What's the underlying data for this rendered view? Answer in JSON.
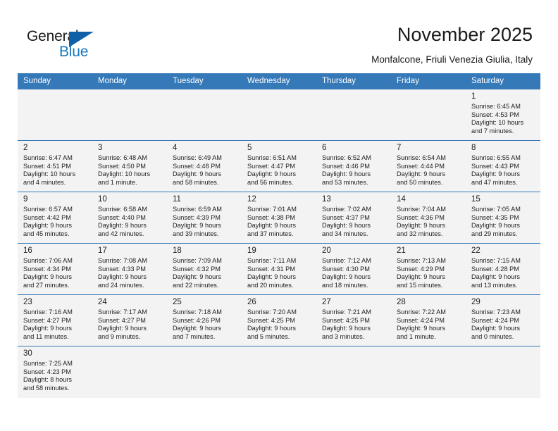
{
  "brand": {
    "name_part1": "General",
    "name_part2": "Blue",
    "triangle_icon": "triangle-icon",
    "accent_color": "#1878be"
  },
  "header": {
    "month_title": "November 2025",
    "location": "Monfalcone, Friuli Venezia Giulia, Italy",
    "header_bg_color": "#3579b8"
  },
  "weekday_headers": [
    "Sunday",
    "Monday",
    "Tuesday",
    "Wednesday",
    "Thursday",
    "Friday",
    "Saturday"
  ],
  "weeks": [
    [
      {
        "empty": true
      },
      {
        "empty": true
      },
      {
        "empty": true
      },
      {
        "empty": true
      },
      {
        "empty": true
      },
      {
        "empty": true
      },
      {
        "day": "1",
        "sunrise": "Sunrise: 6:45 AM",
        "sunset": "Sunset: 4:53 PM",
        "daylight_1": "Daylight: 10 hours",
        "daylight_2": "and 7 minutes."
      }
    ],
    [
      {
        "day": "2",
        "sunrise": "Sunrise: 6:47 AM",
        "sunset": "Sunset: 4:51 PM",
        "daylight_1": "Daylight: 10 hours",
        "daylight_2": "and 4 minutes."
      },
      {
        "day": "3",
        "sunrise": "Sunrise: 6:48 AM",
        "sunset": "Sunset: 4:50 PM",
        "daylight_1": "Daylight: 10 hours",
        "daylight_2": "and 1 minute."
      },
      {
        "day": "4",
        "sunrise": "Sunrise: 6:49 AM",
        "sunset": "Sunset: 4:48 PM",
        "daylight_1": "Daylight: 9 hours",
        "daylight_2": "and 58 minutes."
      },
      {
        "day": "5",
        "sunrise": "Sunrise: 6:51 AM",
        "sunset": "Sunset: 4:47 PM",
        "daylight_1": "Daylight: 9 hours",
        "daylight_2": "and 56 minutes."
      },
      {
        "day": "6",
        "sunrise": "Sunrise: 6:52 AM",
        "sunset": "Sunset: 4:46 PM",
        "daylight_1": "Daylight: 9 hours",
        "daylight_2": "and 53 minutes."
      },
      {
        "day": "7",
        "sunrise": "Sunrise: 6:54 AM",
        "sunset": "Sunset: 4:44 PM",
        "daylight_1": "Daylight: 9 hours",
        "daylight_2": "and 50 minutes."
      },
      {
        "day": "8",
        "sunrise": "Sunrise: 6:55 AM",
        "sunset": "Sunset: 4:43 PM",
        "daylight_1": "Daylight: 9 hours",
        "daylight_2": "and 47 minutes."
      }
    ],
    [
      {
        "day": "9",
        "sunrise": "Sunrise: 6:57 AM",
        "sunset": "Sunset: 4:42 PM",
        "daylight_1": "Daylight: 9 hours",
        "daylight_2": "and 45 minutes."
      },
      {
        "day": "10",
        "sunrise": "Sunrise: 6:58 AM",
        "sunset": "Sunset: 4:40 PM",
        "daylight_1": "Daylight: 9 hours",
        "daylight_2": "and 42 minutes."
      },
      {
        "day": "11",
        "sunrise": "Sunrise: 6:59 AM",
        "sunset": "Sunset: 4:39 PM",
        "daylight_1": "Daylight: 9 hours",
        "daylight_2": "and 39 minutes."
      },
      {
        "day": "12",
        "sunrise": "Sunrise: 7:01 AM",
        "sunset": "Sunset: 4:38 PM",
        "daylight_1": "Daylight: 9 hours",
        "daylight_2": "and 37 minutes."
      },
      {
        "day": "13",
        "sunrise": "Sunrise: 7:02 AM",
        "sunset": "Sunset: 4:37 PM",
        "daylight_1": "Daylight: 9 hours",
        "daylight_2": "and 34 minutes."
      },
      {
        "day": "14",
        "sunrise": "Sunrise: 7:04 AM",
        "sunset": "Sunset: 4:36 PM",
        "daylight_1": "Daylight: 9 hours",
        "daylight_2": "and 32 minutes."
      },
      {
        "day": "15",
        "sunrise": "Sunrise: 7:05 AM",
        "sunset": "Sunset: 4:35 PM",
        "daylight_1": "Daylight: 9 hours",
        "daylight_2": "and 29 minutes."
      }
    ],
    [
      {
        "day": "16",
        "sunrise": "Sunrise: 7:06 AM",
        "sunset": "Sunset: 4:34 PM",
        "daylight_1": "Daylight: 9 hours",
        "daylight_2": "and 27 minutes."
      },
      {
        "day": "17",
        "sunrise": "Sunrise: 7:08 AM",
        "sunset": "Sunset: 4:33 PM",
        "daylight_1": "Daylight: 9 hours",
        "daylight_2": "and 24 minutes."
      },
      {
        "day": "18",
        "sunrise": "Sunrise: 7:09 AM",
        "sunset": "Sunset: 4:32 PM",
        "daylight_1": "Daylight: 9 hours",
        "daylight_2": "and 22 minutes."
      },
      {
        "day": "19",
        "sunrise": "Sunrise: 7:11 AM",
        "sunset": "Sunset: 4:31 PM",
        "daylight_1": "Daylight: 9 hours",
        "daylight_2": "and 20 minutes."
      },
      {
        "day": "20",
        "sunrise": "Sunrise: 7:12 AM",
        "sunset": "Sunset: 4:30 PM",
        "daylight_1": "Daylight: 9 hours",
        "daylight_2": "and 18 minutes."
      },
      {
        "day": "21",
        "sunrise": "Sunrise: 7:13 AM",
        "sunset": "Sunset: 4:29 PM",
        "daylight_1": "Daylight: 9 hours",
        "daylight_2": "and 15 minutes."
      },
      {
        "day": "22",
        "sunrise": "Sunrise: 7:15 AM",
        "sunset": "Sunset: 4:28 PM",
        "daylight_1": "Daylight: 9 hours",
        "daylight_2": "and 13 minutes."
      }
    ],
    [
      {
        "day": "23",
        "sunrise": "Sunrise: 7:16 AM",
        "sunset": "Sunset: 4:27 PM",
        "daylight_1": "Daylight: 9 hours",
        "daylight_2": "and 11 minutes."
      },
      {
        "day": "24",
        "sunrise": "Sunrise: 7:17 AM",
        "sunset": "Sunset: 4:27 PM",
        "daylight_1": "Daylight: 9 hours",
        "daylight_2": "and 9 minutes."
      },
      {
        "day": "25",
        "sunrise": "Sunrise: 7:18 AM",
        "sunset": "Sunset: 4:26 PM",
        "daylight_1": "Daylight: 9 hours",
        "daylight_2": "and 7 minutes."
      },
      {
        "day": "26",
        "sunrise": "Sunrise: 7:20 AM",
        "sunset": "Sunset: 4:25 PM",
        "daylight_1": "Daylight: 9 hours",
        "daylight_2": "and 5 minutes."
      },
      {
        "day": "27",
        "sunrise": "Sunrise: 7:21 AM",
        "sunset": "Sunset: 4:25 PM",
        "daylight_1": "Daylight: 9 hours",
        "daylight_2": "and 3 minutes."
      },
      {
        "day": "28",
        "sunrise": "Sunrise: 7:22 AM",
        "sunset": "Sunset: 4:24 PM",
        "daylight_1": "Daylight: 9 hours",
        "daylight_2": "and 1 minute."
      },
      {
        "day": "29",
        "sunrise": "Sunrise: 7:23 AM",
        "sunset": "Sunset: 4:24 PM",
        "daylight_1": "Daylight: 9 hours",
        "daylight_2": "and 0 minutes."
      }
    ],
    [
      {
        "day": "30",
        "sunrise": "Sunrise: 7:25 AM",
        "sunset": "Sunset: 4:23 PM",
        "daylight_1": "Daylight: 8 hours",
        "daylight_2": "and 58 minutes."
      },
      {
        "empty": true
      },
      {
        "empty": true
      },
      {
        "empty": true
      },
      {
        "empty": true
      },
      {
        "empty": true
      },
      {
        "empty": true
      }
    ]
  ]
}
